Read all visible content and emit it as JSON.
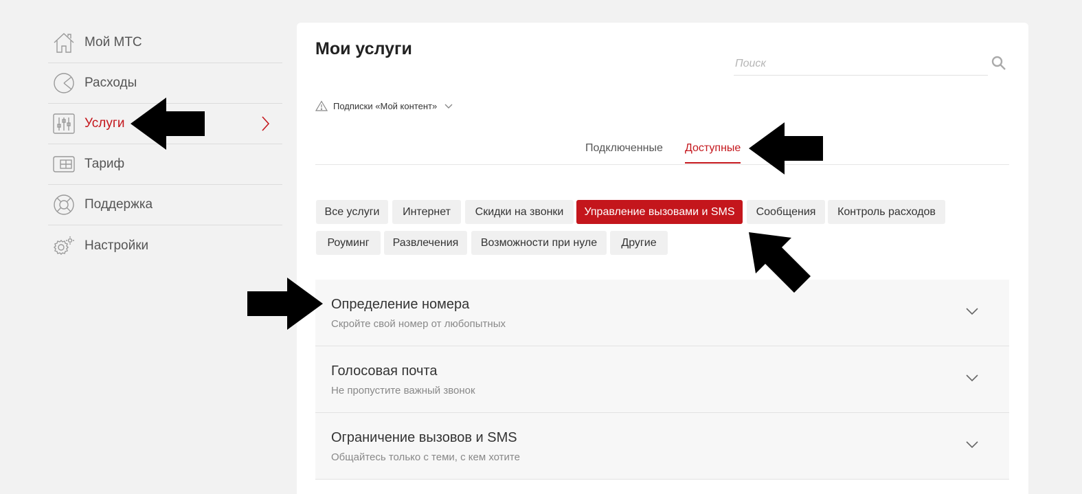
{
  "sidebar": {
    "items": [
      {
        "label": "Мой МТС",
        "icon": "home-icon"
      },
      {
        "label": "Расходы",
        "icon": "pie-chart-icon"
      },
      {
        "label": "Услуги",
        "icon": "sliders-icon",
        "active": true
      },
      {
        "label": "Тариф",
        "icon": "tariff-card-icon"
      },
      {
        "label": "Поддержка",
        "icon": "lifebuoy-icon"
      },
      {
        "label": "Настройки",
        "icon": "gear-icon"
      }
    ]
  },
  "main": {
    "title": "Мои услуги",
    "search": {
      "placeholder": "Поиск"
    },
    "subscriptions_label": "Подписки «Мой контент»",
    "tabs": [
      {
        "label": "Подключенные",
        "active": false
      },
      {
        "label": "Доступные",
        "active": true
      }
    ],
    "chips": [
      {
        "label": "Все услуги"
      },
      {
        "label": "Интернет"
      },
      {
        "label": "Скидки на звонки"
      },
      {
        "label": "Управление вызовами и SMS",
        "active": true
      },
      {
        "label": "Сообщения"
      },
      {
        "label": "Контроль расходов"
      },
      {
        "label": "Роуминг"
      },
      {
        "label": "Развлечения"
      },
      {
        "label": "Возможности при нуле"
      },
      {
        "label": "Другие"
      }
    ],
    "services": [
      {
        "title": "Определение номера",
        "subtitle": "Скройте свой номер от любопытных"
      },
      {
        "title": "Голосовая почта",
        "subtitle": "Не пропустите важный звонок"
      },
      {
        "title": "Ограничение вызовов и SMS",
        "subtitle": "Общайтесь только с теми, с кем хотите"
      }
    ]
  },
  "colors": {
    "accent": "#c4161c",
    "background": "#f2f2f2",
    "card": "#ffffff",
    "chip": "#f0f0f0"
  }
}
